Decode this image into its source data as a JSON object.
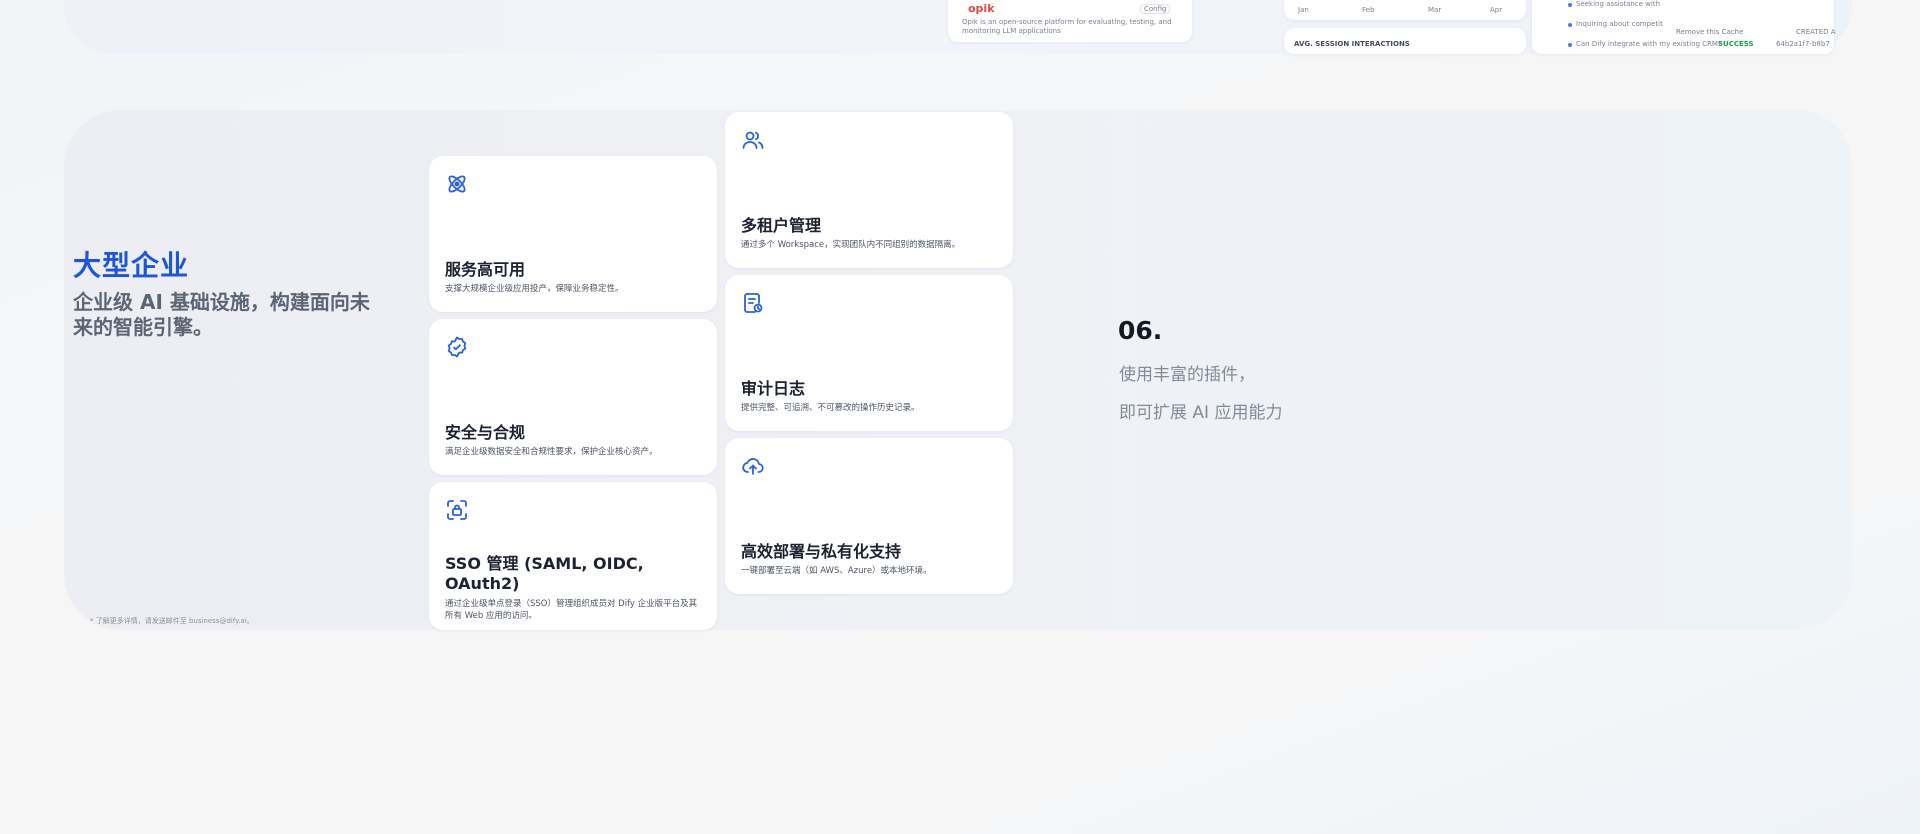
{
  "top_strip": {
    "opik_name": "opik",
    "opik_badge": "Config",
    "opik_desc": "Opik is an open-source platform for evaluating, testing, and monitoring LLM applications",
    "months": [
      "Jan",
      "Feb",
      "Mar",
      "Apr"
    ],
    "session_label": "AVG. SESSION INTERACTIONS",
    "log_items": [
      "Seeking assistance with",
      "Inquiring about competit",
      "Can Dify integrate with my existing CRM?"
    ],
    "remove_cache": "Remove this Cache",
    "created_label": "CREATED A",
    "status_text": "SUCCESS",
    "row_id": "64b2a1f7-b8b7"
  },
  "enterprise": {
    "title": "大型企业",
    "subtitle": "企业级 AI 基础设施，构建面向未来的智能引擎。",
    "footnote": "* 了解更多详情，请发送邮件至 business@dify.ai。"
  },
  "features": [
    {
      "icon": "atom-icon",
      "title": "服务高可用",
      "desc": "支撑大规模企业级应用投产，保障业务稳定性。"
    },
    {
      "icon": "verified-badge-icon",
      "title": "安全与合规",
      "desc": "满足企业级数据安全和合规性要求，保护企业核心资产。"
    },
    {
      "icon": "scan-lock-icon",
      "title": "SSO 管理 (SAML, OIDC, OAuth2)",
      "desc": "通过企业级单点登录（SSO）管理组织成员对 Dify 企业版平台及其所有 Web 应用的访问。"
    },
    {
      "icon": "users-icon",
      "title": "多租户管理",
      "desc": "通过多个 Workspace，实现团队内不同组别的数据隔离。"
    },
    {
      "icon": "audit-log-icon",
      "title": "审计日志",
      "desc": "提供完整、可追溯、不可篡改的操作历史记录。"
    },
    {
      "icon": "cloud-upload-icon",
      "title": "高效部署与私有化支持",
      "desc": "一键部署至云端（如 AWS、Azure）或本地环境。"
    }
  ],
  "plugins": {
    "number": "06.",
    "line1": "使用丰富的插件，",
    "line2": "即可扩展 AI 应用能力"
  },
  "colors": {
    "accent": "#1e56d9",
    "icon": "#2b63d8",
    "success": "#16a34a"
  }
}
